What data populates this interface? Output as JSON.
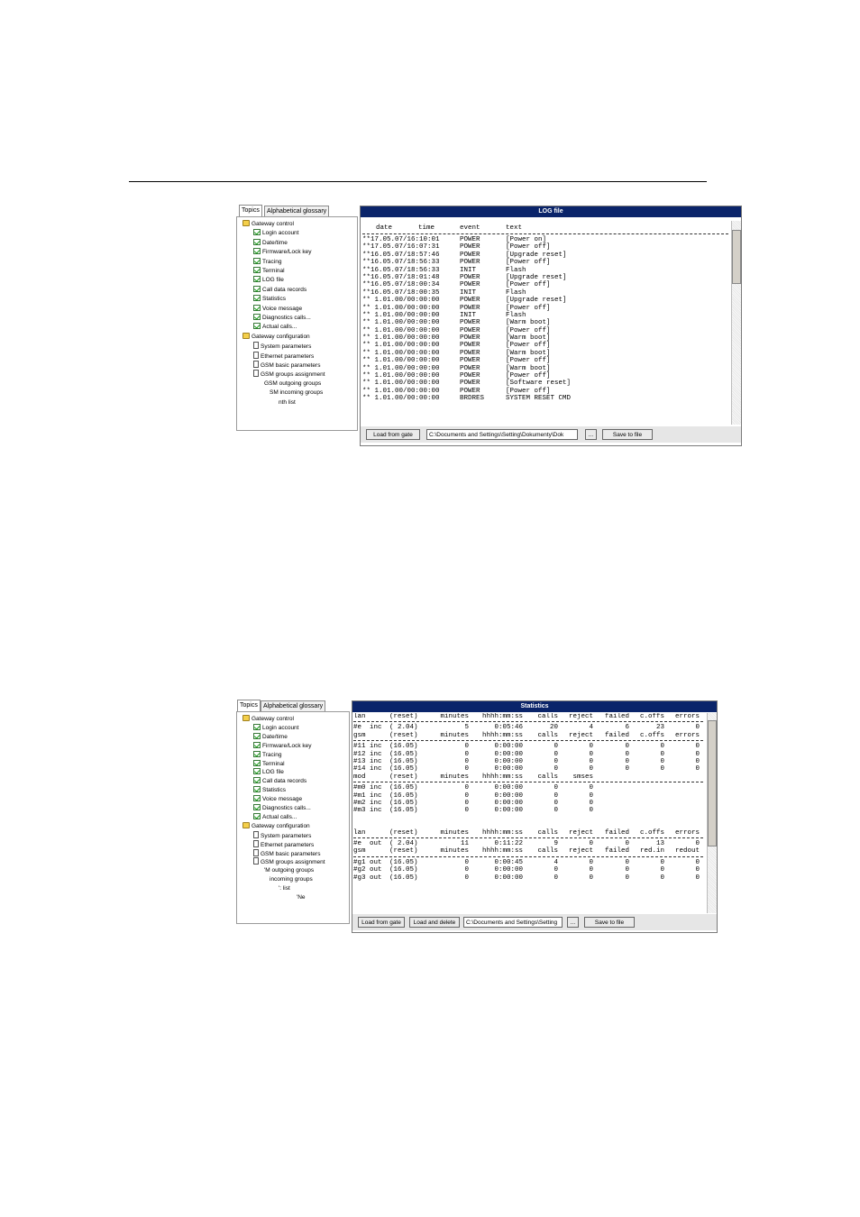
{
  "shot1": {
    "tabs": [
      "Topics",
      "Alphabetical glossary"
    ],
    "tree": [
      {
        "label": "Gateway control",
        "icon": "folder-icon",
        "level": 0
      },
      {
        "label": "Login account",
        "icon": "check-icon",
        "level": 1
      },
      {
        "label": "Date/time",
        "icon": "check-icon",
        "level": 1
      },
      {
        "label": "Firmware/Lock key",
        "icon": "check-icon",
        "level": 1
      },
      {
        "label": "Tracing",
        "icon": "check-icon",
        "level": 1
      },
      {
        "label": "Terminal",
        "icon": "check-icon",
        "level": 1
      },
      {
        "label": "LOG file",
        "icon": "check-icon",
        "level": 1
      },
      {
        "label": "Call data records",
        "icon": "check-icon",
        "level": 1
      },
      {
        "label": "Statistics",
        "icon": "check-icon",
        "level": 1
      },
      {
        "label": "Voice message",
        "icon": "check-icon",
        "level": 1
      },
      {
        "label": "Diagnostics calls...",
        "icon": "check-icon",
        "level": 1
      },
      {
        "label": "Actual calls...",
        "icon": "check-icon",
        "level": 1
      },
      {
        "label": "Gateway configuration",
        "icon": "folder-icon",
        "level": 0
      },
      {
        "label": "System parameters",
        "icon": "document-icon",
        "level": 1
      },
      {
        "label": "Ethernet parameters",
        "icon": "document-icon",
        "level": 1
      },
      {
        "label": "GSM basic parameters",
        "icon": "document-icon",
        "level": 1
      },
      {
        "label": "GSM groups assignment",
        "icon": "document-icon",
        "level": 1
      },
      {
        "label": "GSM outgoing groups",
        "icon": "none",
        "level": 2
      },
      {
        "label": "SM incoming groups",
        "icon": "none",
        "level": 3
      },
      {
        "label": "nth list",
        "icon": "none",
        "level": 4
      }
    ],
    "title": "LOG file",
    "header": {
      "date": "date",
      "time": "time",
      "event": "event",
      "text": "text"
    },
    "rows": [
      {
        "prefix": "**",
        "datetime": "17.05.07/16:10:01",
        "event": "POWER",
        "text": "[Power on]"
      },
      {
        "prefix": "**",
        "datetime": "17.05.07/16:07:31",
        "event": "POWER",
        "text": "[Power off]"
      },
      {
        "prefix": "**",
        "datetime": "16.05.07/18:57:46",
        "event": "POWER",
        "text": "[Upgrade reset]"
      },
      {
        "prefix": "**",
        "datetime": "16.05.07/18:56:33",
        "event": "POWER",
        "text": "[Power off]"
      },
      {
        "prefix": "**",
        "datetime": "16.05.07/18:56:33",
        "event": "INIT",
        "text": "Flash"
      },
      {
        "prefix": "**",
        "datetime": "16.05.07/18:01:48",
        "event": "POWER",
        "text": "[Upgrade reset]"
      },
      {
        "prefix": "**",
        "datetime": "16.05.07/18:00:34",
        "event": "POWER",
        "text": "[Power off]"
      },
      {
        "prefix": "**",
        "datetime": "16.05.07/18:00:35",
        "event": "INIT",
        "text": "Flash"
      },
      {
        "prefix": "**",
        "datetime": " 1.01.00/00:00:00",
        "event": "POWER",
        "text": "[Upgrade reset]"
      },
      {
        "prefix": "**",
        "datetime": " 1.01.00/00:00:00",
        "event": "POWER",
        "text": "[Power off]"
      },
      {
        "prefix": "**",
        "datetime": " 1.01.00/00:00:00",
        "event": "INIT",
        "text": "Flash"
      },
      {
        "prefix": "**",
        "datetime": " 1.01.00/00:00:00",
        "event": "POWER",
        "text": "[Warm boot]"
      },
      {
        "prefix": "**",
        "datetime": " 1.01.00/00:00:00",
        "event": "POWER",
        "text": "[Power off]"
      },
      {
        "prefix": "**",
        "datetime": " 1.01.00/00:00:00",
        "event": "POWER",
        "text": "[Warm boot]"
      },
      {
        "prefix": "**",
        "datetime": " 1.01.00/00:00:00",
        "event": "POWER",
        "text": "[Power off]"
      },
      {
        "prefix": "**",
        "datetime": " 1.01.00/00:00:00",
        "event": "POWER",
        "text": "[Warm boot]"
      },
      {
        "prefix": "**",
        "datetime": " 1.01.00/00:00:00",
        "event": "POWER",
        "text": "[Power off]"
      },
      {
        "prefix": "**",
        "datetime": " 1.01.00/00:00:00",
        "event": "POWER",
        "text": "[Warm boot]"
      },
      {
        "prefix": "**",
        "datetime": " 1.01.00/00:00:00",
        "event": "POWER",
        "text": "[Power off]"
      },
      {
        "prefix": "**",
        "datetime": " 1.01.00/00:00:00",
        "event": "POWER",
        "text": "[Software reset]"
      },
      {
        "prefix": "**",
        "datetime": " 1.01.00/00:00:00",
        "event": "POWER",
        "text": "[Power off]"
      },
      {
        "prefix": "**",
        "datetime": " 1.01.00/00:00:00",
        "event": "BRDRES",
        "text": "SYSTEM RESET CMD"
      }
    ],
    "buttons": {
      "load": "Load from gate",
      "browse": "...",
      "save": "Save to file"
    },
    "path": "C:\\Documents and Settings\\Setting\\Dokumenty\\Dok"
  },
  "shot2": {
    "tabs": [
      "Topics",
      "Alphabetical glossary"
    ],
    "tree": [
      {
        "label": "Gateway control",
        "icon": "folder-icon",
        "level": 0
      },
      {
        "label": "Login account",
        "icon": "check-icon",
        "level": 1
      },
      {
        "label": "Date/time",
        "icon": "check-icon",
        "level": 1
      },
      {
        "label": "Firmware/Lock key",
        "icon": "check-icon",
        "level": 1
      },
      {
        "label": "Tracing",
        "icon": "check-icon",
        "level": 1
      },
      {
        "label": "Terminal",
        "icon": "check-icon",
        "level": 1
      },
      {
        "label": "LOG file",
        "icon": "check-icon",
        "level": 1
      },
      {
        "label": "Call data records",
        "icon": "check-icon",
        "level": 1
      },
      {
        "label": "Statistics",
        "icon": "check-icon",
        "level": 1
      },
      {
        "label": "Voice message",
        "icon": "check-icon",
        "level": 1
      },
      {
        "label": "Diagnostics calls...",
        "icon": "check-icon",
        "level": 1
      },
      {
        "label": "Actual calls...",
        "icon": "check-icon",
        "level": 1
      },
      {
        "label": "Gateway configuration",
        "icon": "folder-icon",
        "level": 0
      },
      {
        "label": "System parameters",
        "icon": "document-icon",
        "level": 1
      },
      {
        "label": "Ethernet parameters",
        "icon": "document-icon",
        "level": 1
      },
      {
        "label": "GSM basic parameters",
        "icon": "document-icon",
        "level": 1
      },
      {
        "label": "GSM groups assignment",
        "icon": "document-icon",
        "level": 1
      },
      {
        "label": "'M outgoing groups",
        "icon": "none",
        "level": 2
      },
      {
        "label": "incoming groups",
        "icon": "none",
        "level": 3
      },
      {
        "label": "': list",
        "icon": "none",
        "level": 4
      },
      {
        "label": "'Ne",
        "icon": "none",
        "level": 5
      }
    ],
    "title": "Statistics",
    "sections": [
      {
        "type": "header",
        "cols": [
          "lan",
          "(reset)",
          "minutes",
          "hhhh:mm:ss",
          "calls",
          "reject",
          "failed",
          "c.offs",
          "errors"
        ]
      },
      {
        "type": "rule"
      },
      {
        "type": "data",
        "cols": [
          "#e  inc",
          "( 2.04)",
          "5",
          "0:05:46",
          "20",
          "4",
          "6",
          "23",
          "0"
        ]
      },
      {
        "type": "header",
        "cols": [
          "gsm",
          "(reset)",
          "minutes",
          "hhhh:mm:ss",
          "calls",
          "reject",
          "failed",
          "c.offs",
          "errors"
        ]
      },
      {
        "type": "rule"
      },
      {
        "type": "data",
        "cols": [
          "#11 inc",
          "(16.05)",
          "0",
          "0:00:00",
          "0",
          "0",
          "0",
          "0",
          "0"
        ]
      },
      {
        "type": "data",
        "cols": [
          "#12 inc",
          "(16.05)",
          "0",
          "0:00:00",
          "0",
          "0",
          "0",
          "0",
          "0"
        ]
      },
      {
        "type": "data",
        "cols": [
          "#13 inc",
          "(16.05)",
          "0",
          "0:00:00",
          "0",
          "0",
          "0",
          "0",
          "0"
        ]
      },
      {
        "type": "data",
        "cols": [
          "#14 inc",
          "(16.05)",
          "0",
          "0:00:00",
          "0",
          "0",
          "0",
          "0",
          "0"
        ]
      },
      {
        "type": "header",
        "cols": [
          "mod",
          "(reset)",
          "minutes",
          "hhhh:mm:ss",
          "calls",
          "smses",
          "",
          "",
          ""
        ]
      },
      {
        "type": "rule"
      },
      {
        "type": "data",
        "cols": [
          "#m0 inc",
          "(16.05)",
          "0",
          "0:00:00",
          "0",
          "0",
          "",
          "",
          ""
        ]
      },
      {
        "type": "data",
        "cols": [
          "#m1 inc",
          "(16.05)",
          "0",
          "0:00:00",
          "0",
          "0",
          "",
          "",
          ""
        ]
      },
      {
        "type": "data",
        "cols": [
          "#m2 inc",
          "(16.05)",
          "0",
          "0:00:00",
          "0",
          "0",
          "",
          "",
          ""
        ]
      },
      {
        "type": "data",
        "cols": [
          "#m3 inc",
          "(16.05)",
          "0",
          "0:00:00",
          "0",
          "0",
          "",
          "",
          ""
        ]
      },
      {
        "type": "blank"
      },
      {
        "type": "header",
        "cols": [
          "lan",
          "(reset)",
          "minutes",
          "hhhh:mm:ss",
          "calls",
          "reject",
          "failed",
          "c.offs",
          "errors"
        ]
      },
      {
        "type": "rule"
      },
      {
        "type": "data",
        "cols": [
          "#e  out",
          "( 2.04)",
          "11",
          "0:11:22",
          "9",
          "0",
          "0",
          "13",
          "0"
        ]
      },
      {
        "type": "header",
        "cols": [
          "gsm",
          "(reset)",
          "minutes",
          "hhhh:mm:ss",
          "calls",
          "reject",
          "failed",
          "red.in",
          "redout"
        ]
      },
      {
        "type": "rule"
      },
      {
        "type": "data",
        "cols": [
          "#g1 out",
          "(16.05)",
          "0",
          "0:00:45",
          "4",
          "0",
          "0",
          "0",
          "0"
        ]
      },
      {
        "type": "data",
        "cols": [
          "#g2 out",
          "(16.05)",
          "0",
          "0:00:00",
          "0",
          "0",
          "0",
          "0",
          "0"
        ]
      },
      {
        "type": "data",
        "cols": [
          "#g3 out",
          "(16.05)",
          "0",
          "0:00:00",
          "0",
          "0",
          "0",
          "0",
          "0"
        ]
      }
    ],
    "buttons": {
      "load": "Load from gate",
      "load_delete": "Load and delete",
      "browse": "...",
      "save": "Save to file"
    },
    "path": "C:\\Documents and Settings\\Setting"
  },
  "colors": {
    "titlebar": "#0a246a",
    "folder": "#f4cf4a",
    "check": "#1a9a1a"
  }
}
